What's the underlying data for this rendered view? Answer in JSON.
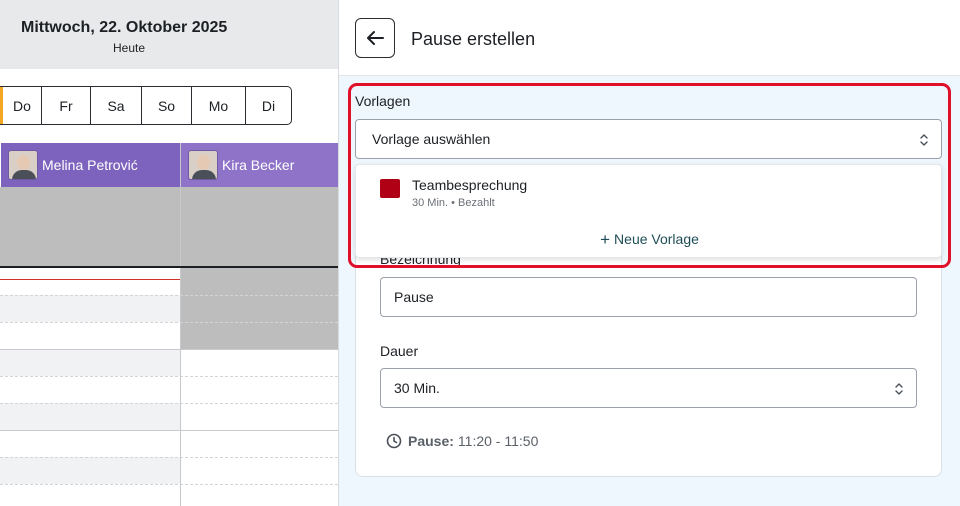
{
  "calendar": {
    "date": "Mittwoch, 22. Oktober 2025",
    "today": "Heute",
    "days": [
      "Do",
      "Fr",
      "Sa",
      "So",
      "Mo",
      "Di"
    ],
    "staff": [
      {
        "name": "Melina Petrović"
      },
      {
        "name": "Kira Becker"
      }
    ]
  },
  "panel": {
    "title": "Pause erstellen",
    "vorlagen": {
      "label": "Vorlagen",
      "select_value": "Vorlage auswählen",
      "templates": [
        {
          "name": "Teambesprechung",
          "meta": "30 Min. • Bezahlt",
          "color": "#b00016"
        }
      ],
      "new_template": "Neue Vorlage"
    },
    "bezeichnung": {
      "label": "Bezeichnung",
      "value": "Pause"
    },
    "dauer": {
      "label": "Dauer",
      "value": "30 Min."
    },
    "pause_info": {
      "label": "Pause:",
      "time": "11:20 - 11:50"
    }
  },
  "colors": {
    "accent_highlight": "#e0102a",
    "staff_header": "#8e73c9",
    "today_marker": "#f5a623"
  }
}
